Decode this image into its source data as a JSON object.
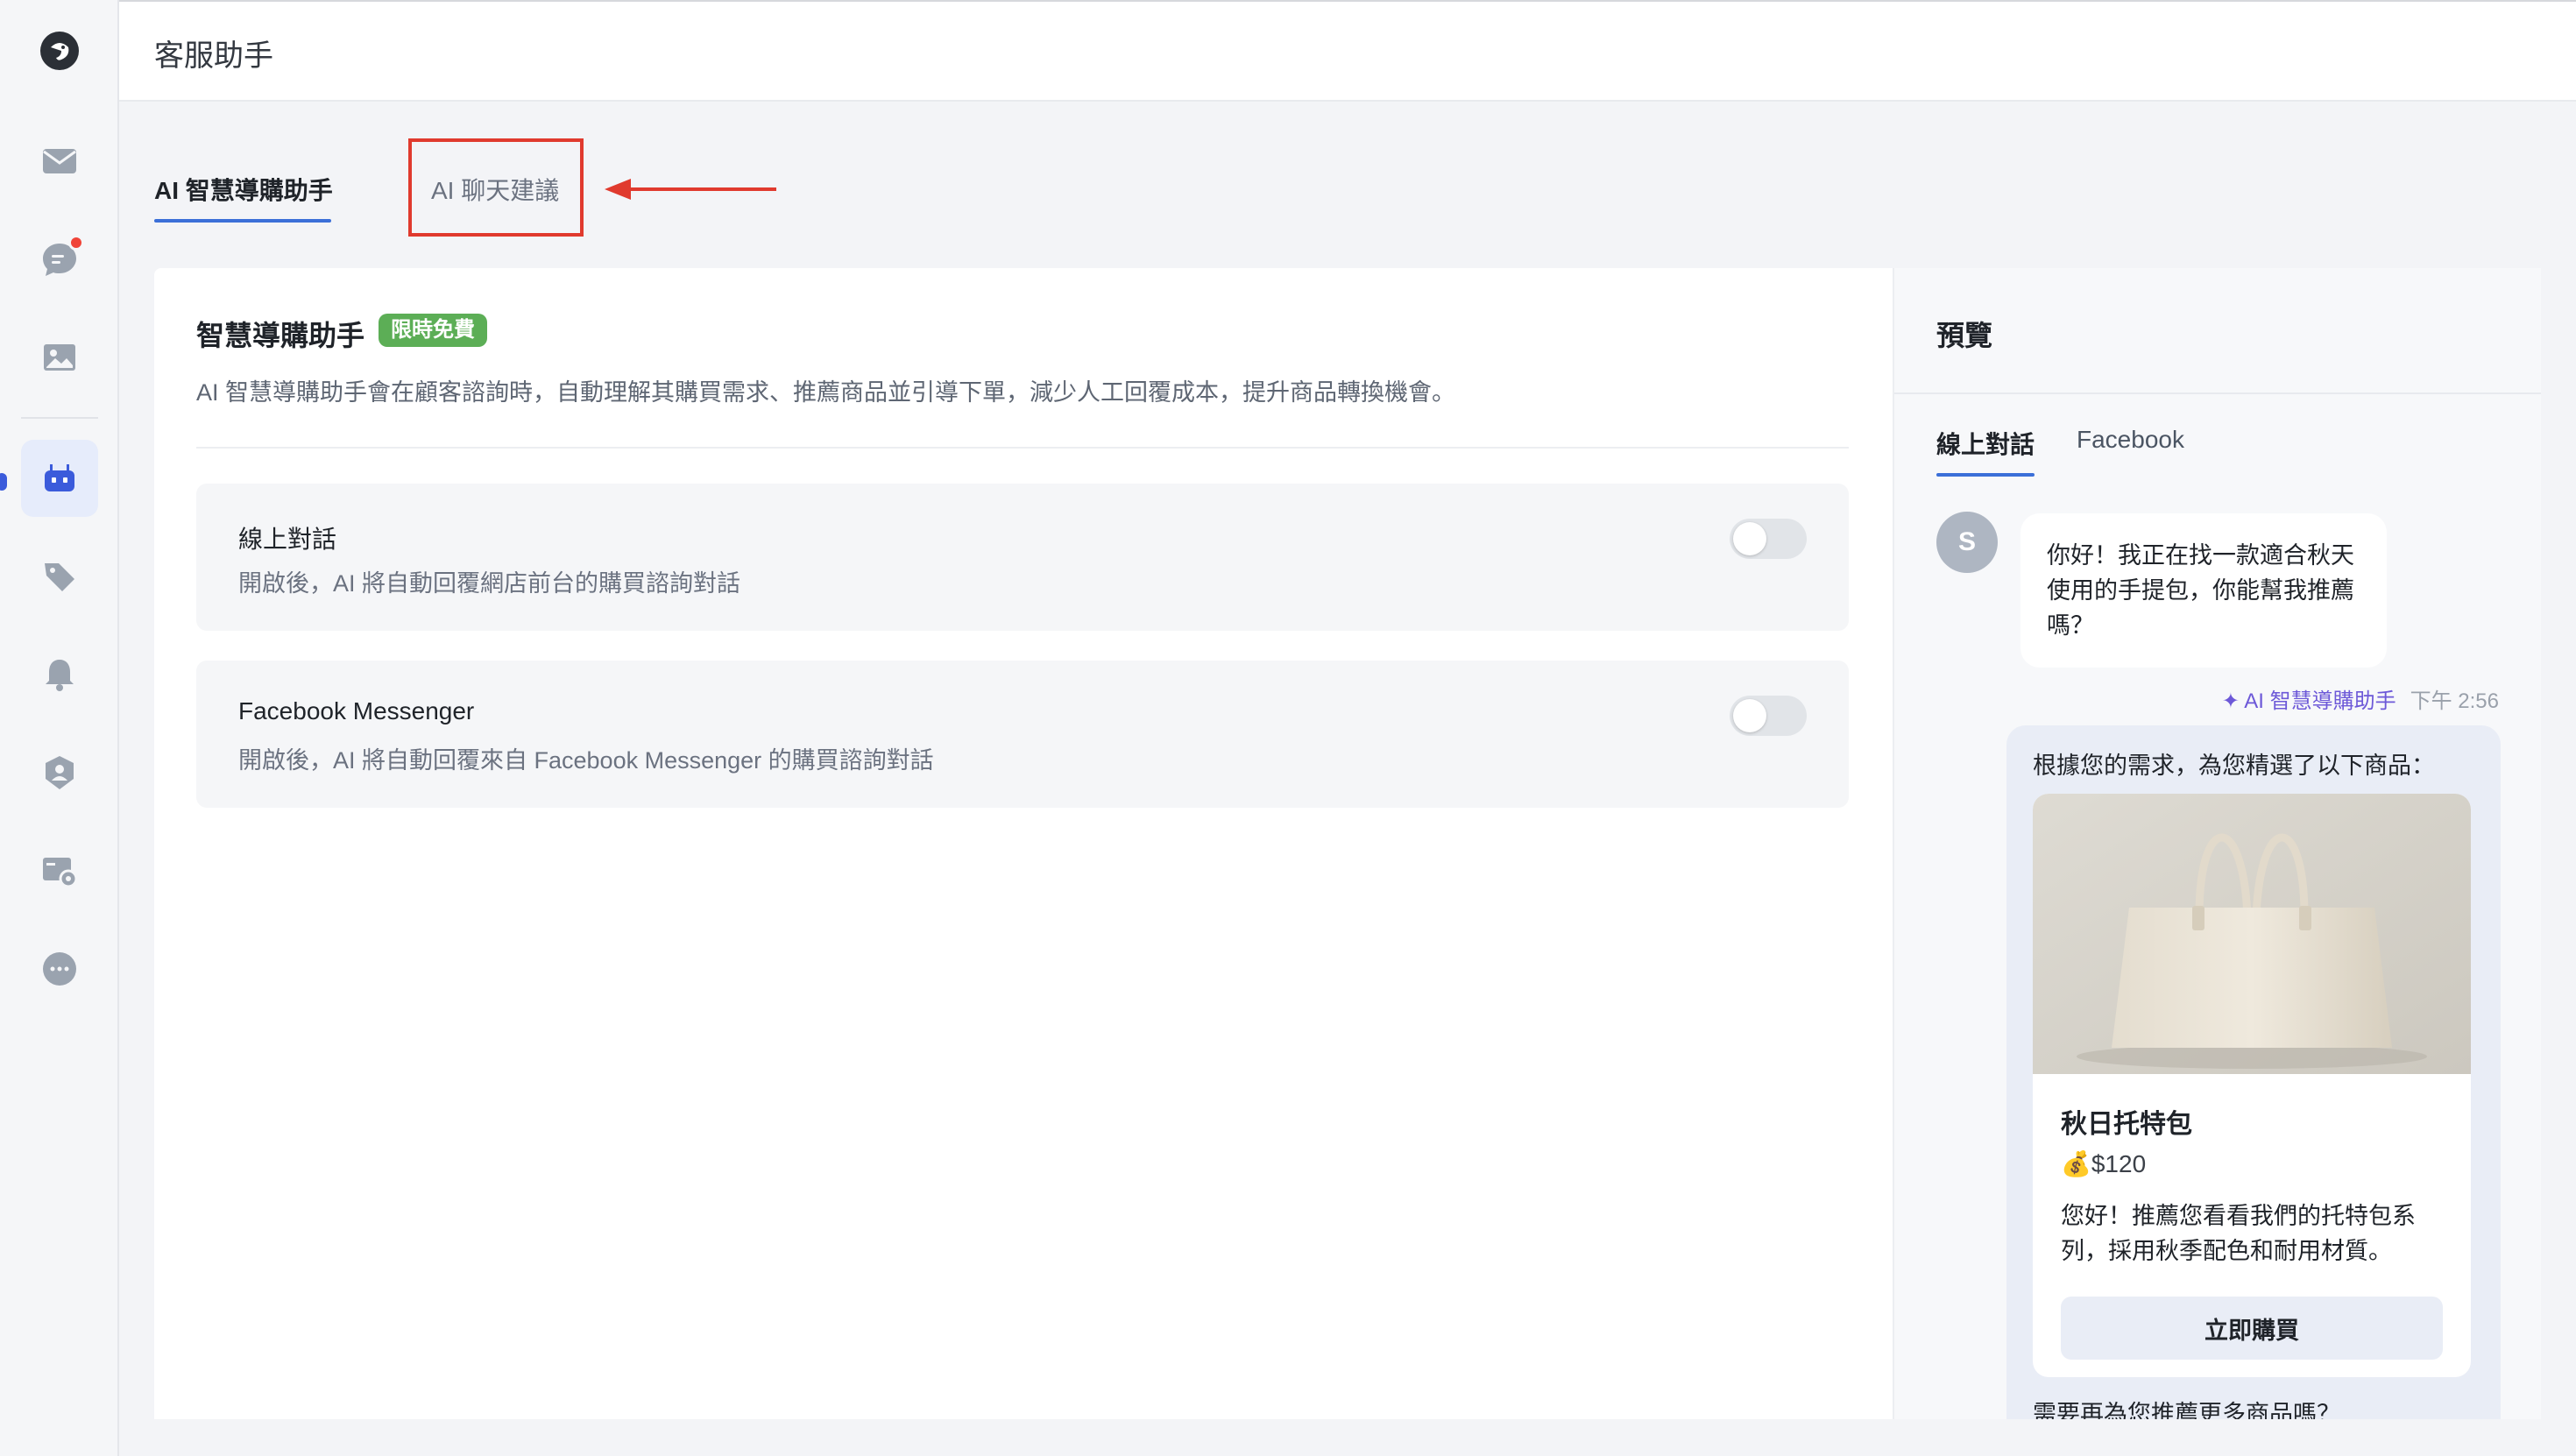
{
  "app": {
    "header_title": "客服助手"
  },
  "sidebar": {
    "items": [
      {
        "icon": "mail-icon"
      },
      {
        "icon": "chat-icon",
        "has_badge": true
      },
      {
        "icon": "image-icon"
      },
      {
        "icon": "robot-icon",
        "active": true
      },
      {
        "icon": "tag-icon"
      },
      {
        "icon": "bell-icon"
      },
      {
        "icon": "user-shield-icon"
      },
      {
        "icon": "card-settings-icon"
      },
      {
        "icon": "more-icon"
      }
    ]
  },
  "tabs": [
    {
      "label": "AI 智慧導購助手",
      "active": true
    },
    {
      "label": "AI 聊天建議",
      "active": false,
      "highlighted": true
    }
  ],
  "main": {
    "title": "智慧導購助手",
    "badge": "限時免費",
    "description": "AI 智慧導購助手會在顧客諮詢時，自動理解其購買需求、推薦商品並引導下單，減少人工回覆成本，提升商品轉換機會。",
    "settings": [
      {
        "title": "線上對話",
        "description": "開啟後，AI 將自動回覆網店前台的購買諮詢對話",
        "enabled": false
      },
      {
        "title": "Facebook Messenger",
        "description": "開啟後，AI 將自動回覆來自 Facebook Messenger 的購買諮詢對話",
        "enabled": false
      }
    ]
  },
  "preview": {
    "title": "預覽",
    "tabs": [
      {
        "label": "線上對話",
        "active": true
      },
      {
        "label": "Facebook",
        "active": false
      }
    ],
    "user_avatar": "S",
    "user_message": "你好！我正在找一款適合秋天使用的手提包，你能幫我推薦嗎？",
    "ai_name": "✦ AI 智慧導購助手",
    "ai_time": "下午 2:56",
    "ai_intro": "根據您的需求，為您精選了以下商品：",
    "product": {
      "name": "秋日托特包",
      "price": "💰$120",
      "description": "您好！推薦您看看我們的托特包系列，採用秋季配色和耐用材質。",
      "button": "立即購買"
    },
    "ai_followup": "需要再為您推薦更多商品嗎？"
  },
  "colors": {
    "accent": "#3b6fd8",
    "badge_green": "#5cae56",
    "highlight_red": "#e03a2e",
    "ai_purple": "#6d59d8"
  }
}
